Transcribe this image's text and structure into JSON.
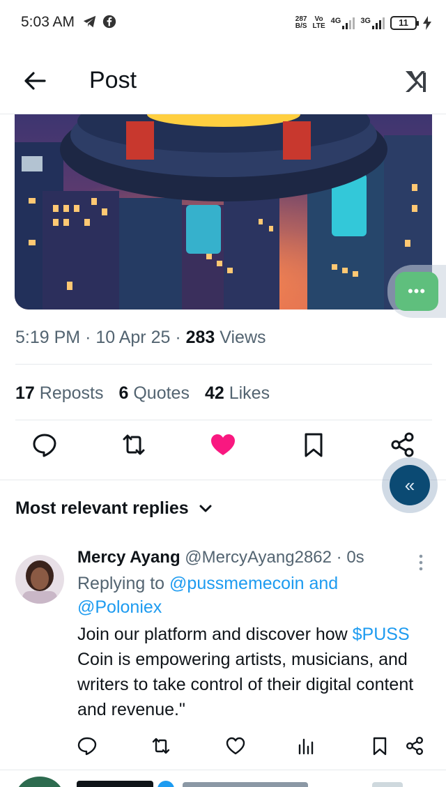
{
  "status_bar": {
    "time": "5:03 AM",
    "data_speed": "287",
    "data_unit": "B/S",
    "volte_top": "Vo",
    "volte_bottom": "LTE",
    "net1": "4G",
    "net2": "3G",
    "battery": "11",
    "icons": [
      "telegram-icon",
      "facebook-icon",
      "signal-icon",
      "battery-icon",
      "charging-icon"
    ]
  },
  "header": {
    "title": "Post",
    "back_icon": "arrow-left-icon",
    "logo_icon": "x-grok-logo-icon"
  },
  "post": {
    "image_desc_icon": "post-image",
    "time": "5:19 PM",
    "date": "10 Apr 25",
    "views_count": "283",
    "views_label": "Views",
    "sep": "·",
    "reposts_count": "17",
    "reposts_label": "Reposts",
    "quotes_count": "6",
    "quotes_label": "Quotes",
    "likes_count": "42",
    "likes_label": "Likes"
  },
  "replies": {
    "sort_label": "Most relevant replies",
    "items": [
      {
        "name": "Mercy Ayang",
        "handle": "@MercyAyang2862",
        "time": "· 0s",
        "replying_prefix": "Replying to ",
        "replying_to_1": "@pussmemecoin",
        "replying_and": " and",
        "replying_to_2": "@Poloniex",
        "text_cashtag": "$PUSS",
        "text_before": "Join our platform and discover how ",
        "text_after": " Coin is empowering artists, musicians, and writers to take control of their digital content and revenue.\""
      }
    ]
  },
  "colors": {
    "accent": "#1d9bf0",
    "like": "#f91880",
    "secondary_text": "#536471",
    "fab_back": "#0b4a73",
    "fab_chat": "#5fbf7d"
  }
}
